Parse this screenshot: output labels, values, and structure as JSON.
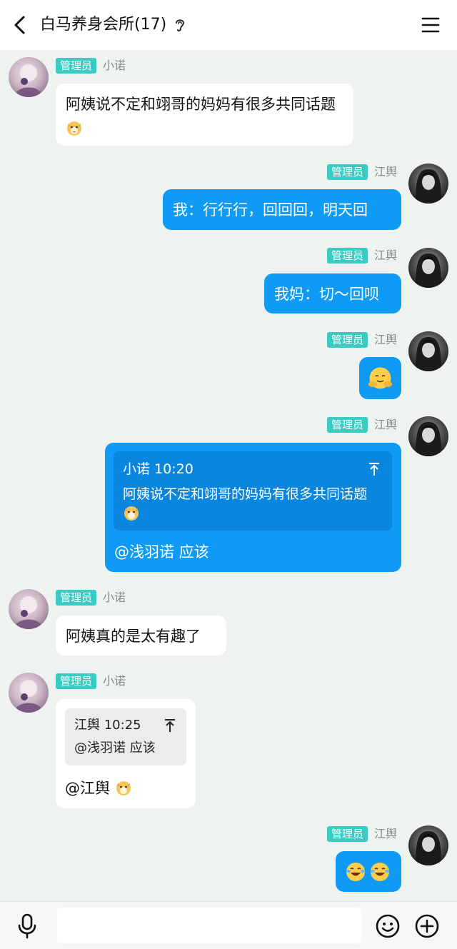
{
  "header": {
    "back_icon": "chevron-left-icon",
    "title": "白马养身会所(17)",
    "ear_icon": "ear-icon",
    "menu_icon": "hamburger-menu-icon"
  },
  "badge_label": "管理员",
  "messages": [
    {
      "side": "left",
      "sender": "小诺",
      "text": "阿姨说不定和翊哥的妈妈有很多共同话题",
      "emoji": "dog-face"
    },
    {
      "side": "right",
      "sender": "江舆",
      "text": "我：行行行，回回回，明天回"
    },
    {
      "side": "right",
      "sender": "江舆",
      "text": "我妈：切～回呗"
    },
    {
      "side": "right",
      "sender": "江舆",
      "emoji": "hug-emoji"
    },
    {
      "side": "right",
      "sender": "江舆",
      "quote": {
        "author_time": "小诺 10:20",
        "text": "阿姨说不定和翊哥的妈妈有很多共同话题",
        "emoji": "dog-face"
      },
      "text": "@浅羽诺 应该"
    },
    {
      "side": "left",
      "sender": "小诺",
      "text": "阿姨真的是太有趣了"
    },
    {
      "side": "left",
      "sender": "小诺",
      "quote": {
        "author_time": "江舆 10:25",
        "text": "@浅羽诺 应该"
      },
      "text": "@江舆",
      "emoji": "dog-face"
    },
    {
      "side": "right",
      "sender": "江舆",
      "emoji": "laugh-cry-emoji x2"
    }
  ],
  "footer": {
    "voice_icon": "microphone-icon",
    "emoji_icon": "smiley-icon",
    "plus_icon": "plus-circle-icon",
    "input_value": ""
  }
}
